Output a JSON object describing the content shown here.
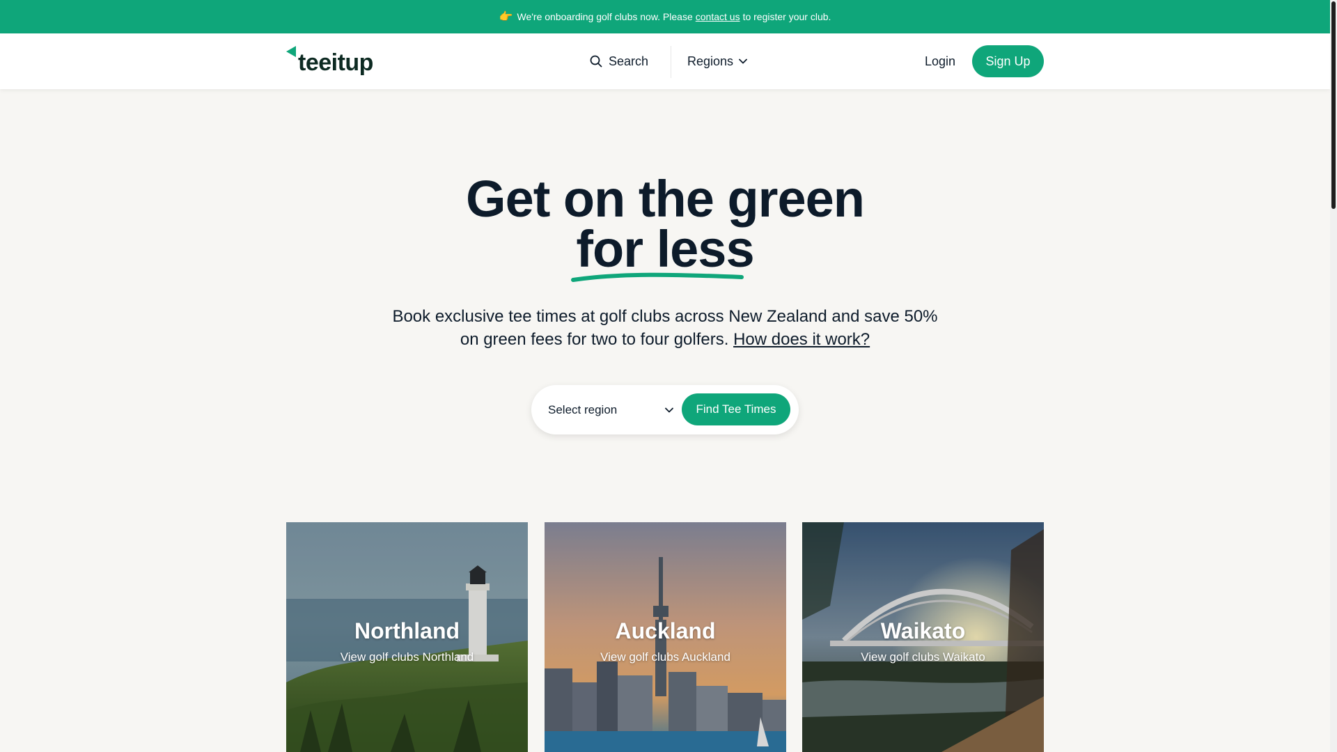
{
  "announcement": {
    "emoji": "👉",
    "text_before": "We're onboarding golf clubs now. Please",
    "link_text": "contact us",
    "text_after": "to register your club."
  },
  "header": {
    "logo_text": "teeitup",
    "nav": {
      "search_label": "Search",
      "regions_label": "Regions"
    },
    "login_label": "Login",
    "signup_label": "Sign Up"
  },
  "hero": {
    "title_line1": "Get on the green",
    "title_line2": "for less",
    "subtitle": "Book exclusive tee times at golf clubs across New Zealand and save 50% on green fees for two to four golfers.",
    "how_link": "How does it work?"
  },
  "region_search": {
    "select_placeholder": "Select region",
    "button_label": "Find Tee Times"
  },
  "regions": [
    {
      "name": "Northland",
      "link": "View golf clubs Northland"
    },
    {
      "name": "Auckland",
      "link": "View golf clubs Auckland"
    },
    {
      "name": "Waikato",
      "link": "View golf clubs Waikato"
    }
  ],
  "colors": {
    "brand_green": "#0fa67a",
    "text_dark": "#0d1b2a",
    "background": "#f7f6f3"
  }
}
